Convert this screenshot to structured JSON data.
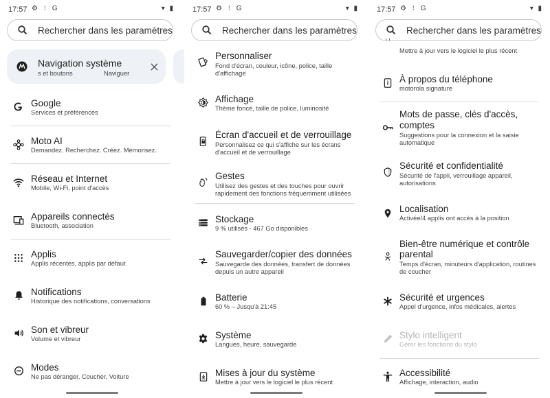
{
  "status_bar": {
    "time": "17:57",
    "left_icons": "⚙ ⁝ G",
    "right_icons": "▾ ▮"
  },
  "search": {
    "placeholder": "Rechercher dans les paramètres"
  },
  "card": {
    "title": "Navigation système",
    "subtitle_left": "s et boutons",
    "subtitle_right": "Naviguer",
    "close_icon": "close-icon"
  },
  "panel1": {
    "items": [
      {
        "title": "Google",
        "subtitle": "Services et préférences",
        "icon": "google-icon"
      },
      {
        "title": "Moto AI",
        "subtitle": "Demandez. Recherchez. Créez. Mémorisez.",
        "icon": "moto-ai-icon"
      },
      {
        "title": "Réseau et Internet",
        "subtitle": "Mobile, Wi-Fi, point d'accès",
        "icon": "wifi-icon"
      },
      {
        "title": "Appareils connectés",
        "subtitle": "Bluetooth, association",
        "icon": "connected-devices-icon"
      },
      {
        "title": "Applis",
        "subtitle": "Applis récentes, applis par défaut",
        "icon": "apps-icon"
      },
      {
        "title": "Notifications",
        "subtitle": "Historique des notifications, conversations",
        "icon": "bell-icon"
      },
      {
        "title": "Son et vibreur",
        "subtitle": "Volume et vibreur",
        "icon": "volume-icon"
      },
      {
        "title": "Modes",
        "subtitle": "Ne pas déranger, Coucher, Voiture",
        "icon": "modes-icon"
      }
    ]
  },
  "panel2": {
    "items": [
      {
        "title": "Personnaliser",
        "subtitle1": "Fond d'écran, couleur, icône, police, taille",
        "subtitle2": "d'affichage",
        "icon": "personalize-icon"
      },
      {
        "title": "Affichage",
        "subtitle1": "Thème foncé, taille de police, luminosité",
        "subtitle2": "",
        "icon": "brightness-icon"
      },
      {
        "title": "Écran d'accueil et de verrouillage",
        "subtitle1": "Personnalisez ce qui s'affiche sur les écrans",
        "subtitle2": "d'accueil et de verrouillage",
        "icon": "lock-screen-icon"
      },
      {
        "title": "Gestes",
        "subtitle1": "Utilisez des gestes et des touches pour ouvrir",
        "subtitle2": "rapidement des fonctions fréquemment utilisées",
        "icon": "gesture-icon"
      },
      {
        "title": "Stockage",
        "subtitle1": "9 % utilisés - 467 Go disponibles",
        "subtitle2": "",
        "icon": "storage-icon"
      },
      {
        "title": "Sauvegarder/copier des données",
        "subtitle1": "Sauvegarde des données, transfert de données",
        "subtitle2": "depuis un autre appareil",
        "icon": "backup-icon"
      },
      {
        "title": "Batterie",
        "subtitle1": "60 % – Jusqu'à 21:45",
        "subtitle2": "",
        "icon": "battery-icon"
      },
      {
        "title": "Système",
        "subtitle1": "Langues, heure, sauvegarde",
        "subtitle2": "",
        "icon": "gear-icon"
      },
      {
        "title": "Mises à jour du système",
        "subtitle1": "Mettre à jour vers le logiciel le plus récent",
        "subtitle2": "",
        "icon": "system-update-icon"
      }
    ]
  },
  "panel3": {
    "top_partial": "Mettre à jour vers le logiciel le plus récent",
    "items": [
      {
        "title1": "À propos du téléphone",
        "title2": "",
        "subtitle1": "motorola signature",
        "subtitle2": "",
        "icon": "phone-info-icon"
      },
      {
        "title1": "Mots de passe, clés d'accès,",
        "title2": "comptes",
        "subtitle1": "Suggestions pour la connexion et la saisie",
        "subtitle2": "automatique",
        "icon": "key-icon"
      },
      {
        "title1": "Sécurité et confidentialité",
        "title2": "",
        "subtitle1": "Sécurité de l'appli, verrouillage appareil,",
        "subtitle2": "autorisations",
        "icon": "shield-icon"
      },
      {
        "title1": "Localisation",
        "title2": "",
        "subtitle1": "Activée/4 applis ont accès à la position",
        "subtitle2": "",
        "icon": "location-icon"
      },
      {
        "title1": "Bien-être numérique et contrôle",
        "title2": "parental",
        "subtitle1": "Temps d'écran, minuteurs d'application, routines",
        "subtitle2": "de coucher",
        "icon": "wellbeing-icon"
      },
      {
        "title1": "Sécurité et urgences",
        "title2": "",
        "subtitle1": "Appel d'urgence, infos médicales, alertes",
        "subtitle2": "",
        "icon": "emergency-icon"
      },
      {
        "title1": "Stylo intelligent",
        "title2": "",
        "subtitle1": "Gérer les fonctions du stylo",
        "subtitle2": "",
        "icon": "stylus-icon"
      },
      {
        "title1": "Accessibilité",
        "title2": "",
        "subtitle1": "Affichage, interaction, audio",
        "subtitle2": "",
        "icon": "accessibility-icon"
      }
    ]
  }
}
